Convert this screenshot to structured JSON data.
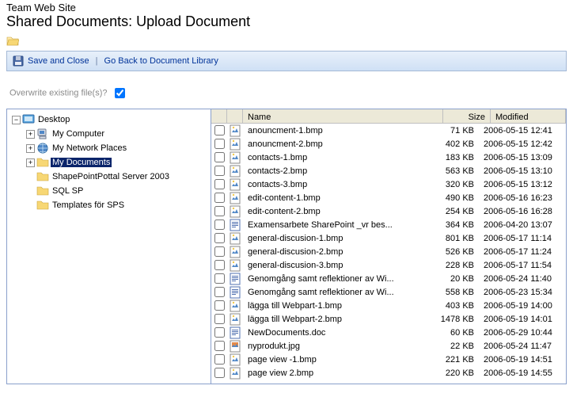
{
  "header": {
    "site_title": "Team Web Site",
    "page_title": "Shared Documents: Upload Document"
  },
  "toolbar": {
    "save_label": "Save and Close",
    "separator": "|",
    "back_label": "Go Back to Document Library"
  },
  "overwrite": {
    "label": "Overwrite existing file(s)?",
    "checked": true
  },
  "tree": {
    "root": "Desktop",
    "children": [
      {
        "label": "My Computer",
        "icon": "computer",
        "exp": "+"
      },
      {
        "label": "My Network Places",
        "icon": "network",
        "exp": "+"
      },
      {
        "label": "My Documents",
        "icon": "folder",
        "exp": "+",
        "selected": true
      },
      {
        "label": "ShapePointPottal Server 2003",
        "icon": "folder",
        "exp": ""
      },
      {
        "label": "SQL SP",
        "icon": "folder",
        "exp": ""
      },
      {
        "label": "Templates för SPS",
        "icon": "folder",
        "exp": ""
      }
    ]
  },
  "columns": {
    "name": "Name",
    "size": "Size",
    "modified": "Modified"
  },
  "files": [
    {
      "name": "anouncment-1.bmp",
      "icon": "bmp",
      "size": "71 KB",
      "modified": "2006-05-15 12:41"
    },
    {
      "name": "anouncment-2.bmp",
      "icon": "bmp",
      "size": "402 KB",
      "modified": "2006-05-15 12:42"
    },
    {
      "name": "contacts-1.bmp",
      "icon": "bmp",
      "size": "183 KB",
      "modified": "2006-05-15 13:09"
    },
    {
      "name": "contacts-2.bmp",
      "icon": "bmp",
      "size": "563 KB",
      "modified": "2006-05-15 13:10"
    },
    {
      "name": "contacts-3.bmp",
      "icon": "bmp",
      "size": "320 KB",
      "modified": "2006-05-15 13:12"
    },
    {
      "name": "edit-content-1.bmp",
      "icon": "bmp",
      "size": "490 KB",
      "modified": "2006-05-16 16:23"
    },
    {
      "name": "edit-content-2.bmp",
      "icon": "bmp",
      "size": "254 KB",
      "modified": "2006-05-16 16:28"
    },
    {
      "name": "Examensarbete SharePoint _vr bes...",
      "icon": "doc",
      "size": "364 KB",
      "modified": "2006-04-20 13:07"
    },
    {
      "name": "general-discusion-1.bmp",
      "icon": "bmp",
      "size": "801 KB",
      "modified": "2006-05-17 11:14"
    },
    {
      "name": "general-discusion-2.bmp",
      "icon": "bmp",
      "size": "526 KB",
      "modified": "2006-05-17 11:24"
    },
    {
      "name": "general-discusion-3.bmp",
      "icon": "bmp",
      "size": "228 KB",
      "modified": "2006-05-17 11:54"
    },
    {
      "name": "Genomgång samt reflektioner av Wi...",
      "icon": "doc",
      "size": "20 KB",
      "modified": "2006-05-24 11:40"
    },
    {
      "name": "Genomgång samt reflektioner av Wi...",
      "icon": "doc",
      "size": "558 KB",
      "modified": "2006-05-23 15:34"
    },
    {
      "name": "lägga till Webpart-1.bmp",
      "icon": "bmp",
      "size": "403 KB",
      "modified": "2006-05-19 14:00"
    },
    {
      "name": "lägga till Webpart-2.bmp",
      "icon": "bmp",
      "size": "1478 KB",
      "modified": "2006-05-19 14:01"
    },
    {
      "name": "NewDocuments.doc",
      "icon": "doc",
      "size": "60 KB",
      "modified": "2006-05-29 10:44"
    },
    {
      "name": "nyprodukt.jpg",
      "icon": "jpg",
      "size": "22 KB",
      "modified": "2006-05-24 11:47"
    },
    {
      "name": "page view -1.bmp",
      "icon": "bmp",
      "size": "221 KB",
      "modified": "2006-05-19 14:51"
    },
    {
      "name": "page view 2.bmp",
      "icon": "bmp",
      "size": "220 KB",
      "modified": "2006-05-19 14:55"
    }
  ]
}
